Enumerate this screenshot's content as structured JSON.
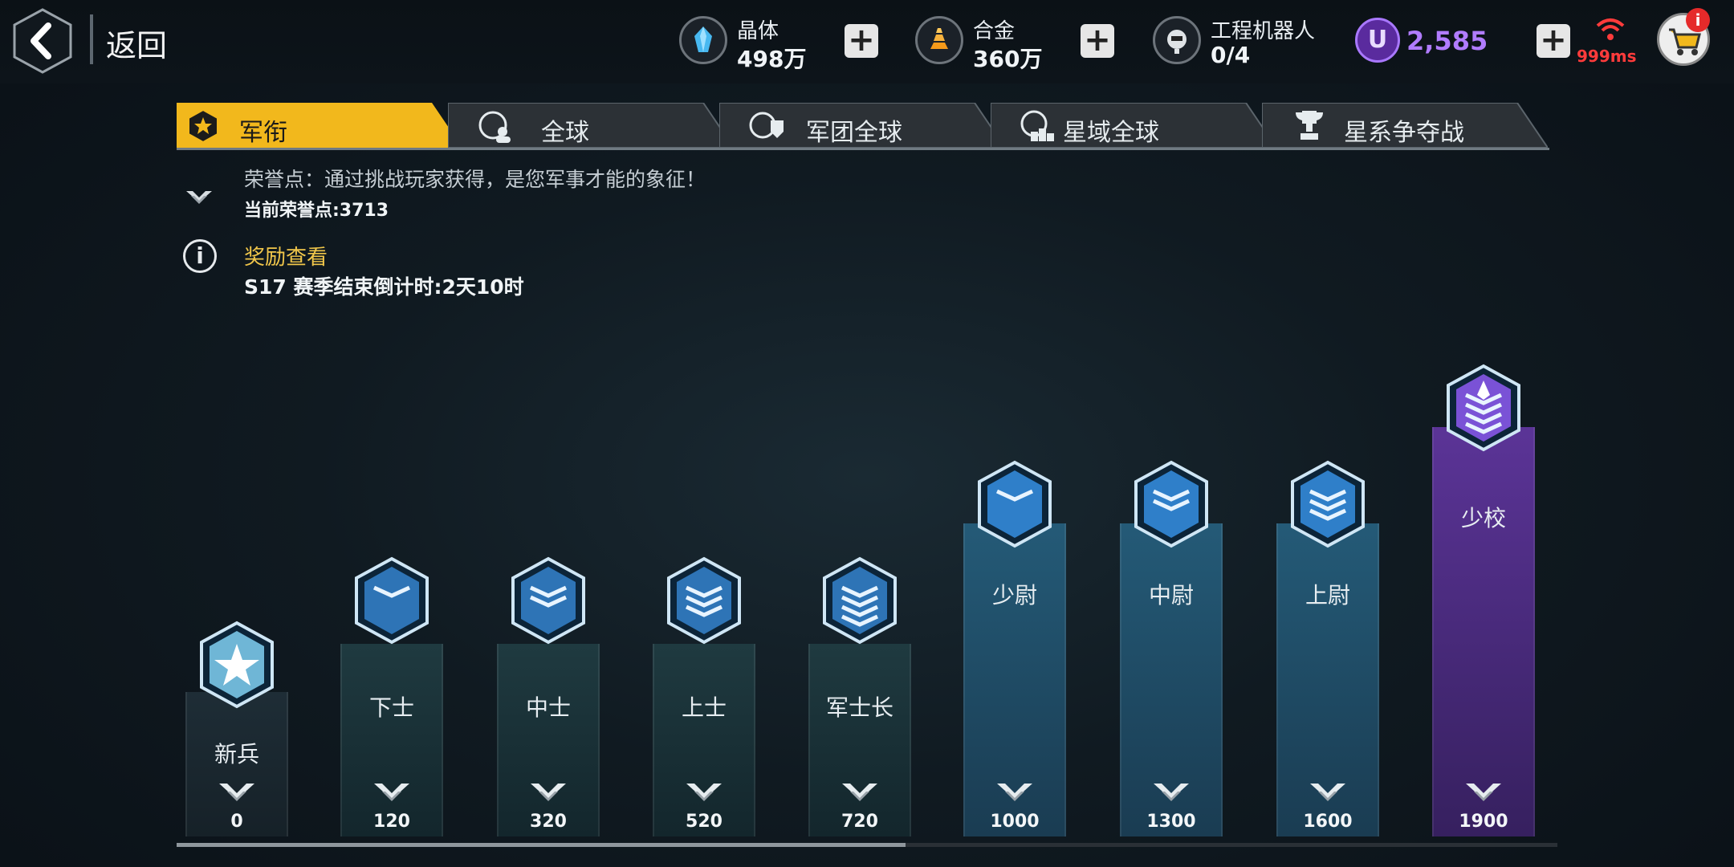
{
  "header": {
    "back_label": "返回",
    "resources": [
      {
        "name": "晶体",
        "value": "498万",
        "icon": "crystal-icon"
      },
      {
        "name": "合金",
        "value": "360万",
        "icon": "alloy-icon"
      },
      {
        "name": "工程机器人",
        "value": "0/4",
        "icon": "robot-icon"
      }
    ],
    "currency": {
      "symbol": "U",
      "value": "2,585"
    },
    "ping": "999ms",
    "cart_badge": "i"
  },
  "tabs": [
    {
      "label": "军衔",
      "active": true,
      "icon": "rank-star-icon"
    },
    {
      "label": "全球",
      "active": false,
      "icon": "globe-user-icon"
    },
    {
      "label": "军团全球",
      "active": false,
      "icon": "legion-globe-icon"
    },
    {
      "label": "星域全球",
      "active": false,
      "icon": "galaxy-podium-icon"
    },
    {
      "label": "星系争夺战",
      "active": false,
      "icon": "trophy-icon"
    }
  ],
  "info": {
    "honor_desc": "荣誉点：通过挑战玩家获得，是您军事才能的象征！",
    "current_honor": "当前荣誉点:3713",
    "reward_link": "奖励查看",
    "season_countdown": "S17 赛季结束倒计时:2天10时"
  },
  "ranks": [
    {
      "name": "新兵",
      "points": "0",
      "tier": "recruit"
    },
    {
      "name": "下士",
      "points": "120",
      "tier": "nco"
    },
    {
      "name": "中士",
      "points": "320",
      "tier": "nco"
    },
    {
      "name": "上士",
      "points": "520",
      "tier": "nco"
    },
    {
      "name": "军士长",
      "points": "720",
      "tier": "nco"
    },
    {
      "name": "少尉",
      "points": "1000",
      "tier": "officer"
    },
    {
      "name": "中尉",
      "points": "1300",
      "tier": "officer"
    },
    {
      "name": "上尉",
      "points": "1600",
      "tier": "officer"
    },
    {
      "name": "少校",
      "points": "1900",
      "tier": "major"
    }
  ],
  "colors": {
    "tab_active": "#f2b81c",
    "tab_inactive": "#2c3136",
    "officer_band": "#1f4a63",
    "major_band": "#4f2f86",
    "link_gold": "#f0c64a",
    "currency_purple": "#b17cff",
    "ping_red": "#ff3b3b"
  },
  "scroll_progress": 0.53
}
